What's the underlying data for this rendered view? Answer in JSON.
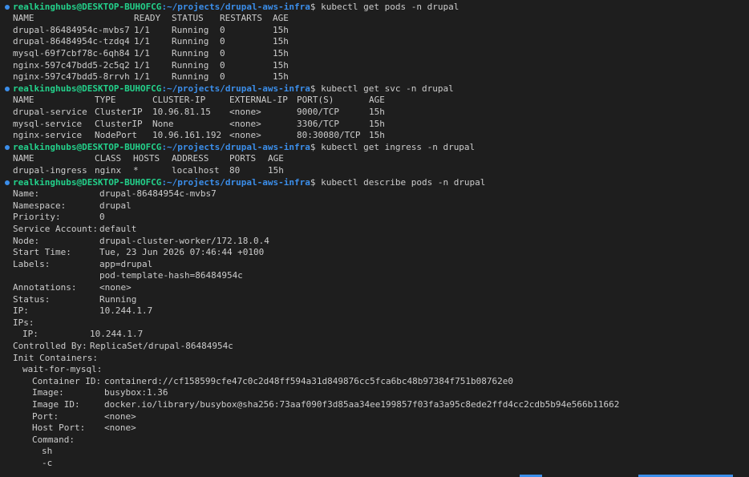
{
  "theme": {
    "background": "#1e1e1e",
    "text": "#cccccc",
    "user": "#23d18b",
    "path": "#3b8eea",
    "prompt_dot": "#3b8eea"
  },
  "prompt": {
    "user_host": "realkinghubs@DESKTOP-BUHOFCG",
    "path": ":~/projects/drupal-aws-infra",
    "symbol": "$"
  },
  "commands": {
    "get_pods": "kubectl get pods -n drupal",
    "get_svc": "kubectl get svc -n drupal",
    "get_ingress": "kubectl get ingress -n drupal",
    "describe_pods": "kubectl describe pods -n drupal"
  },
  "pods": {
    "headers": [
      "NAME",
      "READY",
      "STATUS",
      "RESTARTS",
      "AGE"
    ],
    "rows": [
      [
        "drupal-86484954c-mvbs7",
        "1/1",
        "Running",
        "0",
        "15h"
      ],
      [
        "drupal-86484954c-tzdq4",
        "1/1",
        "Running",
        "0",
        "15h"
      ],
      [
        "mysql-69f7cbf78c-6qh84",
        "1/1",
        "Running",
        "0",
        "15h"
      ],
      [
        "nginx-597c47bdd5-2c5q2",
        "1/1",
        "Running",
        "0",
        "15h"
      ],
      [
        "nginx-597c47bdd5-8rrvh",
        "1/1",
        "Running",
        "0",
        "15h"
      ]
    ]
  },
  "services": {
    "headers": [
      "NAME",
      "TYPE",
      "CLUSTER-IP",
      "EXTERNAL-IP",
      "PORT(S)",
      "AGE"
    ],
    "rows": [
      [
        "drupal-service",
        "ClusterIP",
        "10.96.81.15",
        "<none>",
        "9000/TCP",
        "15h"
      ],
      [
        "mysql-service",
        "ClusterIP",
        "None",
        "<none>",
        "3306/TCP",
        "15h"
      ],
      [
        "nginx-service",
        "NodePort",
        "10.96.161.192",
        "<none>",
        "80:30080/TCP",
        "15h"
      ]
    ]
  },
  "ingress": {
    "headers": [
      "NAME",
      "CLASS",
      "HOSTS",
      "ADDRESS",
      "PORTS",
      "AGE"
    ],
    "rows": [
      [
        "drupal-ingress",
        "nginx",
        "*",
        "localhost",
        "80",
        "15h"
      ]
    ]
  },
  "describe": {
    "fields": [
      [
        "Name:",
        "drupal-86484954c-mvbs7"
      ],
      [
        "Namespace:",
        "drupal"
      ],
      [
        "Priority:",
        "0"
      ],
      [
        "Service Account:",
        "default"
      ],
      [
        "Node:",
        "drupal-cluster-worker/172.18.0.4"
      ],
      [
        "Start Time:",
        "Tue, 23 Jun 2026 07:46:44 +0100"
      ],
      [
        "Labels:",
        "app=drupal"
      ],
      [
        "",
        "pod-template-hash=86484954c"
      ],
      [
        "Annotations:",
        "<none>"
      ],
      [
        "Status:",
        "Running"
      ],
      [
        "IP:",
        "10.244.1.7"
      ]
    ],
    "ips_label": "IPs:",
    "ip_sub_label": "IP:",
    "ip_sub_value": "10.244.1.7",
    "controlled_by_label": "Controlled By:",
    "controlled_by_value": "ReplicaSet/drupal-86484954c",
    "init_containers_label": "Init Containers:",
    "container_name": "wait-for-mysql:",
    "container_fields": [
      [
        "Container ID:",
        "containerd://cf158599cfe47c0c2d48ff594a31d849876cc5fca6bc48b97384f751b08762e0"
      ],
      [
        "Image:",
        "busybox:1.36"
      ],
      [
        "Image ID:",
        "docker.io/library/busybox@sha256:73aaf090f3d85aa34ee199857f03fa3a95c8ede2ffd4cc2cdb5b94e566b11662"
      ],
      [
        "Port:",
        "<none>"
      ],
      [
        "Host Port:",
        "<none>"
      ]
    ],
    "command_label": "Command:",
    "command_args": [
      "sh",
      "-c"
    ]
  }
}
